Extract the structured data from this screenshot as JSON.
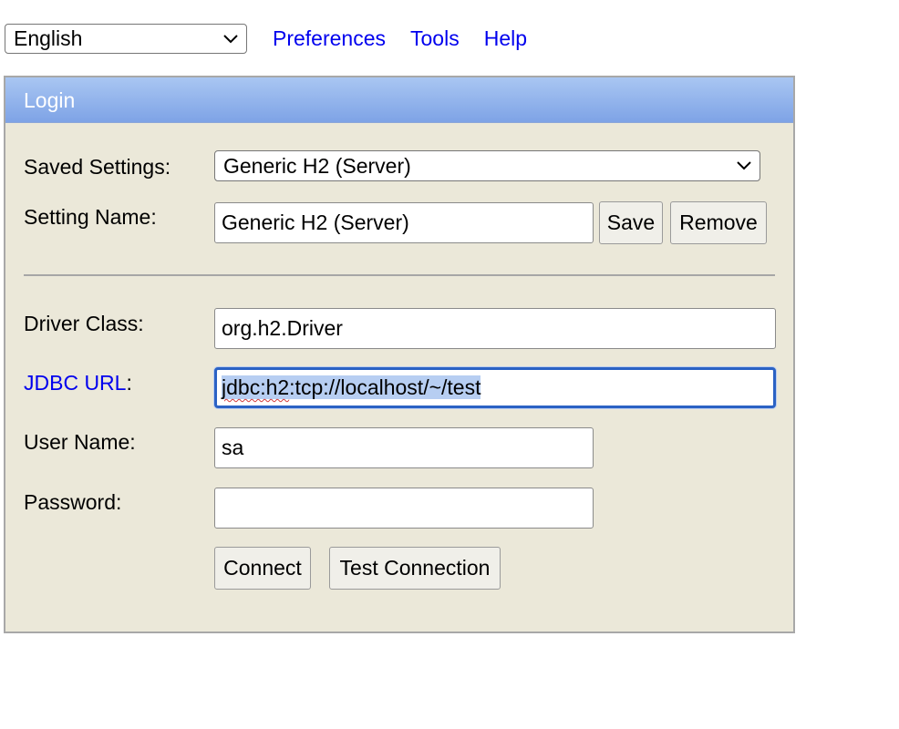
{
  "topbar": {
    "language": "English",
    "links": [
      "Preferences",
      "Tools",
      "Help"
    ]
  },
  "login": {
    "title": "Login",
    "saved_settings_label": "Saved Settings:",
    "saved_settings_value": "Generic H2 (Server)",
    "setting_name_label": "Setting Name:",
    "setting_name_value": "Generic H2 (Server)",
    "save_label": "Save",
    "remove_label": "Remove",
    "driver_class_label": "Driver Class:",
    "driver_class_value": "org.h2.Driver",
    "jdbc_url_label": "JDBC URL",
    "jdbc_url_colon": ":",
    "jdbc_url_value_marked": "jdbc:h2",
    "jdbc_url_value_rest": ":tcp://localhost/~/test",
    "user_name_label": "User Name:",
    "user_name_value": "sa",
    "password_label": "Password:",
    "password_value": "",
    "connect_label": "Connect",
    "test_connection_label": "Test Connection"
  },
  "colors": {
    "header_gradient_top": "#a9c6f2",
    "header_gradient_bottom": "#7ea3e6",
    "panel_bg": "#ebe8d9",
    "link": "#0000ee",
    "focus_border": "#2b62c4",
    "selection": "#b7cef2"
  },
  "icons": {
    "dropdown": "chevron-down-icon"
  }
}
